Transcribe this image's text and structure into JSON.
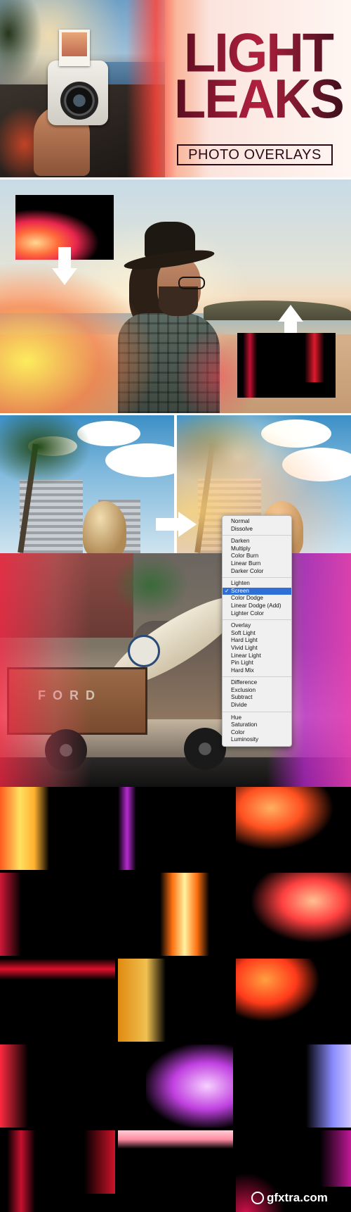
{
  "hero": {
    "title_line1": "LIGHT",
    "title_line2": "LEAKS",
    "subtitle": "PHOTO OVERLAYS"
  },
  "blend_menu": {
    "groups": [
      [
        "Normal",
        "Dissolve"
      ],
      [
        "Darken",
        "Multiply",
        "Color Burn",
        "Linear Burn",
        "Darker Color"
      ],
      [
        "Lighten",
        "Screen",
        "Color Dodge",
        "Linear Dodge (Add)",
        "Lighter Color"
      ],
      [
        "Overlay",
        "Soft Light",
        "Hard Light",
        "Vivid Light",
        "Linear Light",
        "Pin Light",
        "Hard Mix"
      ],
      [
        "Difference",
        "Exclusion",
        "Subtract",
        "Divide"
      ],
      [
        "Hue",
        "Saturation",
        "Color",
        "Luminosity"
      ]
    ],
    "selected": "Screen",
    "check_glyph": "✓"
  },
  "truck": {
    "tailgate_text": "FORD"
  },
  "watermark": "gfxtra.com",
  "colors": {
    "title_dark": "#2b0a16",
    "menu_highlight": "#2f6fd6"
  }
}
